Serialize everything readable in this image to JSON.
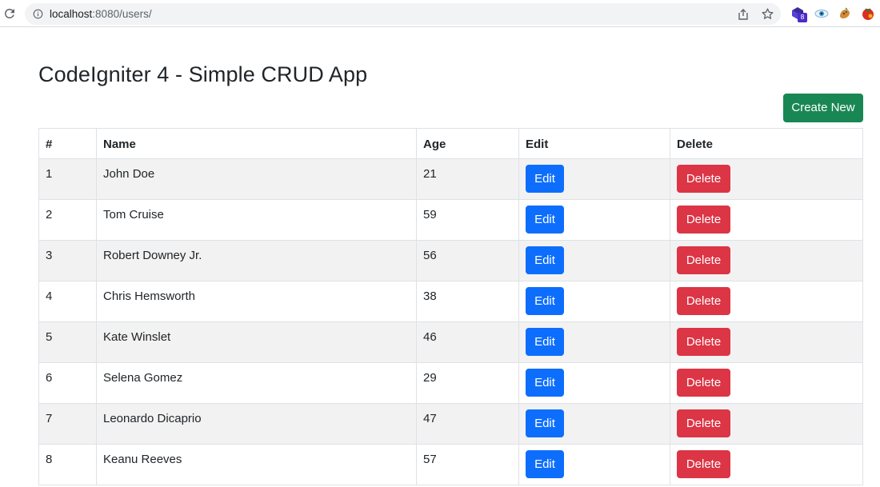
{
  "browser": {
    "url_host": "localhost",
    "url_rest": ":8080/users/",
    "extension_badge": "8"
  },
  "page": {
    "title": "CodeIgniter 4 - Simple CRUD App",
    "create_label": "Create New"
  },
  "table": {
    "headers": [
      "#",
      "Name",
      "Age",
      "Edit",
      "Delete"
    ],
    "rows": [
      {
        "id": "1",
        "name": "John Doe",
        "age": "21",
        "edit": "Edit",
        "delete": "Delete"
      },
      {
        "id": "2",
        "name": "Tom Cruise",
        "age": "59",
        "edit": "Edit",
        "delete": "Delete"
      },
      {
        "id": "3",
        "name": "Robert Downey Jr.",
        "age": "56",
        "edit": "Edit",
        "delete": "Delete"
      },
      {
        "id": "4",
        "name": "Chris Hemsworth",
        "age": "38",
        "edit": "Edit",
        "delete": "Delete"
      },
      {
        "id": "5",
        "name": "Kate Winslet",
        "age": "46",
        "edit": "Edit",
        "delete": "Delete"
      },
      {
        "id": "6",
        "name": "Selena Gomez",
        "age": "29",
        "edit": "Edit",
        "delete": "Delete"
      },
      {
        "id": "7",
        "name": "Leonardo Dicaprio",
        "age": "47",
        "edit": "Edit",
        "delete": "Delete"
      },
      {
        "id": "8",
        "name": "Keanu Reeves",
        "age": "57",
        "edit": "Edit",
        "delete": "Delete"
      }
    ]
  },
  "colors": {
    "create": "#198754",
    "edit": "#0d6efd",
    "delete": "#dc3545",
    "stripe": "#f2f2f2"
  },
  "icons": [
    "reload-icon",
    "info-icon",
    "share-icon",
    "star-icon",
    "extension-icon",
    "eye-extension-icon",
    "cookie-extension-icon",
    "tomato-extension-icon"
  ]
}
